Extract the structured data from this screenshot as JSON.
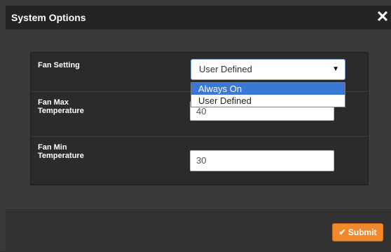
{
  "header": {
    "title": "System Options",
    "close_icon": "close-icon"
  },
  "form": {
    "fan_setting": {
      "label": "Fan Setting",
      "selected_value": "User Defined",
      "options": [
        "Always On",
        "User Defined"
      ],
      "highlighted_option": "Always On"
    },
    "fan_max_temperature": {
      "label_line1": "Fan Max",
      "label_line2": "Temperature",
      "value": "40"
    },
    "fan_min_temperature": {
      "label_line1": "Fan Min",
      "label_line2": "Temperature",
      "value": "30"
    }
  },
  "footer": {
    "submit_label": "Submit",
    "submit_icon": "check-icon",
    "accent_color": "#f0892b"
  }
}
